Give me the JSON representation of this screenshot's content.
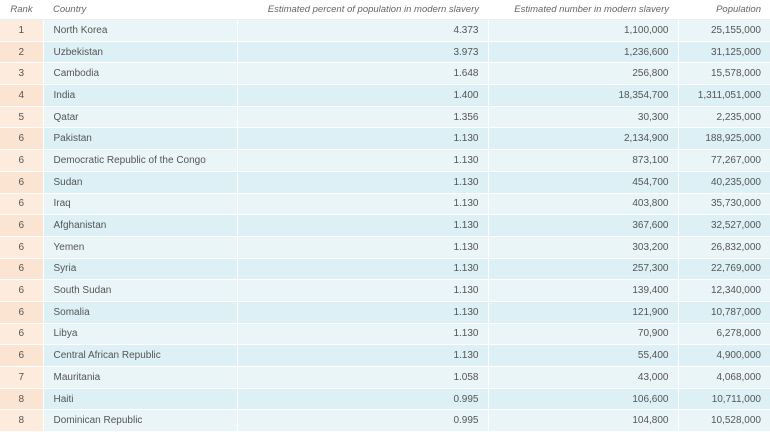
{
  "table": {
    "headers": {
      "rank": "Rank",
      "country": "Country",
      "percent": "Estimated percent of population in modern slavery",
      "number": "Estimated number in modern slavery",
      "population": "Population"
    },
    "rows": [
      {
        "rank": "1",
        "country": "North Korea",
        "percent": "4.373",
        "number": "1,100,000",
        "population": "25,155,000"
      },
      {
        "rank": "2",
        "country": "Uzbekistan",
        "percent": "3.973",
        "number": "1,236,600",
        "population": "31,125,000"
      },
      {
        "rank": "3",
        "country": "Cambodia",
        "percent": "1.648",
        "number": "256,800",
        "population": "15,578,000"
      },
      {
        "rank": "4",
        "country": "India",
        "percent": "1.400",
        "number": "18,354,700",
        "population": "1,311,051,000"
      },
      {
        "rank": "5",
        "country": "Qatar",
        "percent": "1.356",
        "number": "30,300",
        "population": "2,235,000"
      },
      {
        "rank": "6",
        "country": "Pakistan",
        "percent": "1.130",
        "number": "2,134,900",
        "population": "188,925,000"
      },
      {
        "rank": "6",
        "country": "Democratic Republic of the Congo",
        "percent": "1.130",
        "number": "873,100",
        "population": "77,267,000"
      },
      {
        "rank": "6",
        "country": "Sudan",
        "percent": "1.130",
        "number": "454,700",
        "population": "40,235,000"
      },
      {
        "rank": "6",
        "country": "Iraq",
        "percent": "1.130",
        "number": "403,800",
        "population": "35,730,000"
      },
      {
        "rank": "6",
        "country": "Afghanistan",
        "percent": "1.130",
        "number": "367,600",
        "population": "32,527,000"
      },
      {
        "rank": "6",
        "country": "Yemen",
        "percent": "1.130",
        "number": "303,200",
        "population": "26,832,000"
      },
      {
        "rank": "6",
        "country": "Syria",
        "percent": "1.130",
        "number": "257,300",
        "population": "22,769,000"
      },
      {
        "rank": "6",
        "country": "South Sudan",
        "percent": "1.130",
        "number": "139,400",
        "population": "12,340,000"
      },
      {
        "rank": "6",
        "country": "Somalia",
        "percent": "1.130",
        "number": "121,900",
        "population": "10,787,000"
      },
      {
        "rank": "6",
        "country": "Libya",
        "percent": "1.130",
        "number": "70,900",
        "population": "6,278,000"
      },
      {
        "rank": "6",
        "country": "Central African Republic",
        "percent": "1.130",
        "number": "55,400",
        "population": "4,900,000"
      },
      {
        "rank": "7",
        "country": "Mauritania",
        "percent": "1.058",
        "number": "43,000",
        "population": "4,068,000"
      },
      {
        "rank": "8",
        "country": "Haiti",
        "percent": "0.995",
        "number": "106,600",
        "population": "10,711,000"
      },
      {
        "rank": "8",
        "country": "Dominican Republic",
        "percent": "0.995",
        "number": "104,800",
        "population": "10,528,000"
      }
    ]
  },
  "colors": {
    "rank_cell_bg": "#fde9d9",
    "row_odd_bg": "#eaf5f8",
    "row_even_bg": "#dcf0f5",
    "text": "#555555"
  }
}
